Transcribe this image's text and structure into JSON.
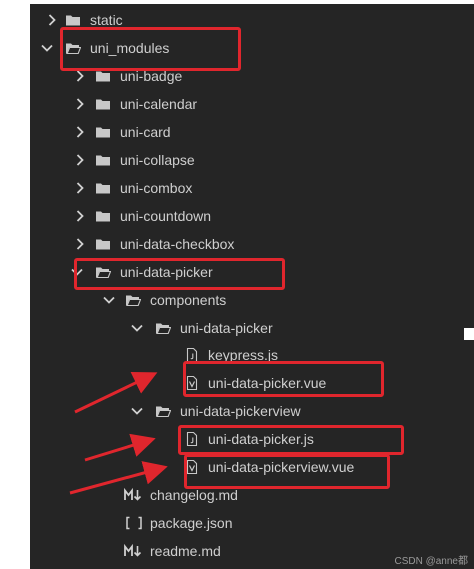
{
  "tree": {
    "items": [
      {
        "label": "static",
        "icon": "folder-icon",
        "chevron": "right"
      },
      {
        "label": "uni_modules",
        "icon": "folder-open-icon",
        "chevron": "down"
      },
      {
        "label": "uni-badge",
        "icon": "folder-icon",
        "chevron": "right"
      },
      {
        "label": "uni-calendar",
        "icon": "folder-icon",
        "chevron": "right"
      },
      {
        "label": "uni-card",
        "icon": "folder-icon",
        "chevron": "right"
      },
      {
        "label": "uni-collapse",
        "icon": "folder-icon",
        "chevron": "right"
      },
      {
        "label": "uni-combox",
        "icon": "folder-icon",
        "chevron": "right"
      },
      {
        "label": "uni-countdown",
        "icon": "folder-icon",
        "chevron": "right"
      },
      {
        "label": "uni-data-checkbox",
        "icon": "folder-icon",
        "chevron": "right"
      },
      {
        "label": "uni-data-picker",
        "icon": "folder-open-icon",
        "chevron": "down"
      },
      {
        "label": "components",
        "icon": "folder-open-icon",
        "chevron": "down"
      },
      {
        "label": "uni-data-picker",
        "icon": "folder-open-icon",
        "chevron": "down"
      },
      {
        "label": "keypress.js",
        "icon": "js-file-icon",
        "chevron": "none"
      },
      {
        "label": "uni-data-picker.vue",
        "icon": "vue-file-icon",
        "chevron": "none"
      },
      {
        "label": "uni-data-pickerview",
        "icon": "folder-open-icon",
        "chevron": "down"
      },
      {
        "label": "uni-data-picker.js",
        "icon": "js-file-icon",
        "chevron": "none"
      },
      {
        "label": "uni-data-pickerview.vue",
        "icon": "vue-file-icon",
        "chevron": "none"
      },
      {
        "label": "changelog.md",
        "icon": "markdown-file-icon",
        "chevron": "none"
      },
      {
        "label": "package.json",
        "icon": "json-file-icon",
        "chevron": "none"
      },
      {
        "label": "readme.md",
        "icon": "markdown-file-icon",
        "chevron": "none"
      }
    ]
  },
  "watermark": "CSDN @anne都",
  "colors": {
    "tree_background": "#252525",
    "text": "#cfcfcf",
    "icon": "#c8c8c8",
    "annotation_red": "#e0262d"
  }
}
